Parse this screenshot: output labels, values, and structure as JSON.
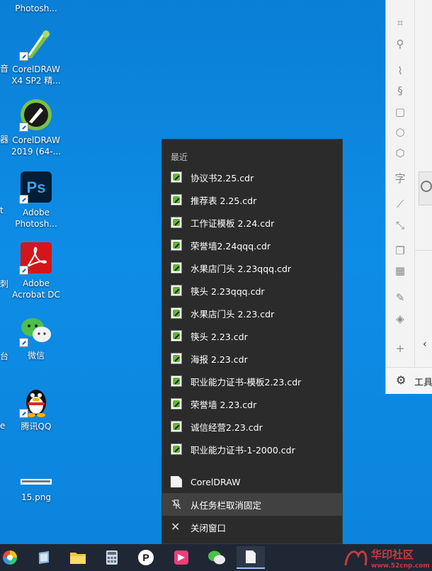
{
  "desktop": {
    "icons": [
      {
        "label_line1": "Photosh...",
        "label_line2": ""
      },
      {
        "label_line1": "CorelDRAW",
        "label_line2": "X4 SP2 精..."
      },
      {
        "label_line1": "CorelDRAW",
        "label_line2": "2019 (64-..."
      },
      {
        "label_line1": "Adobe",
        "label_line2": "Photosh..."
      },
      {
        "label_line1": "Adobe",
        "label_line2": "Acrobat DC"
      },
      {
        "label_line1": "微信",
        "label_line2": ""
      },
      {
        "label_line1": "腾讯QQ",
        "label_line2": ""
      },
      {
        "label_line1": "15.png",
        "label_line2": ""
      }
    ],
    "edge_labels": [
      "音",
      "器",
      "t",
      "刺",
      "台",
      "e"
    ]
  },
  "app_panel": {
    "bottom_label": "工具"
  },
  "jump_list": {
    "section_title": "最近",
    "recent_files": [
      "协议书2.25.cdr",
      "推荐表 2.25.cdr",
      "工作证模板 2.24.cdr",
      "荣誉墙2.24qqq.cdr",
      "水果店门头  2.23qqq.cdr",
      "筷头 2.23qqq.cdr",
      "水果店门头  2.23.cdr",
      "筷头 2.23.cdr",
      "海报 2.23.cdr",
      "职业能力证书-模板2.23.cdr",
      "荣誉墙 2.23.cdr",
      "诚信经营2.23.cdr",
      "职业能力证书-1-2000.cdr"
    ],
    "app_item": "CorelDRAW",
    "unpin_item": "从任务栏取消固定",
    "close_item": "关闭窗口"
  },
  "watermark": {
    "text": "华印社区",
    "url": "www.52cnp.com"
  }
}
